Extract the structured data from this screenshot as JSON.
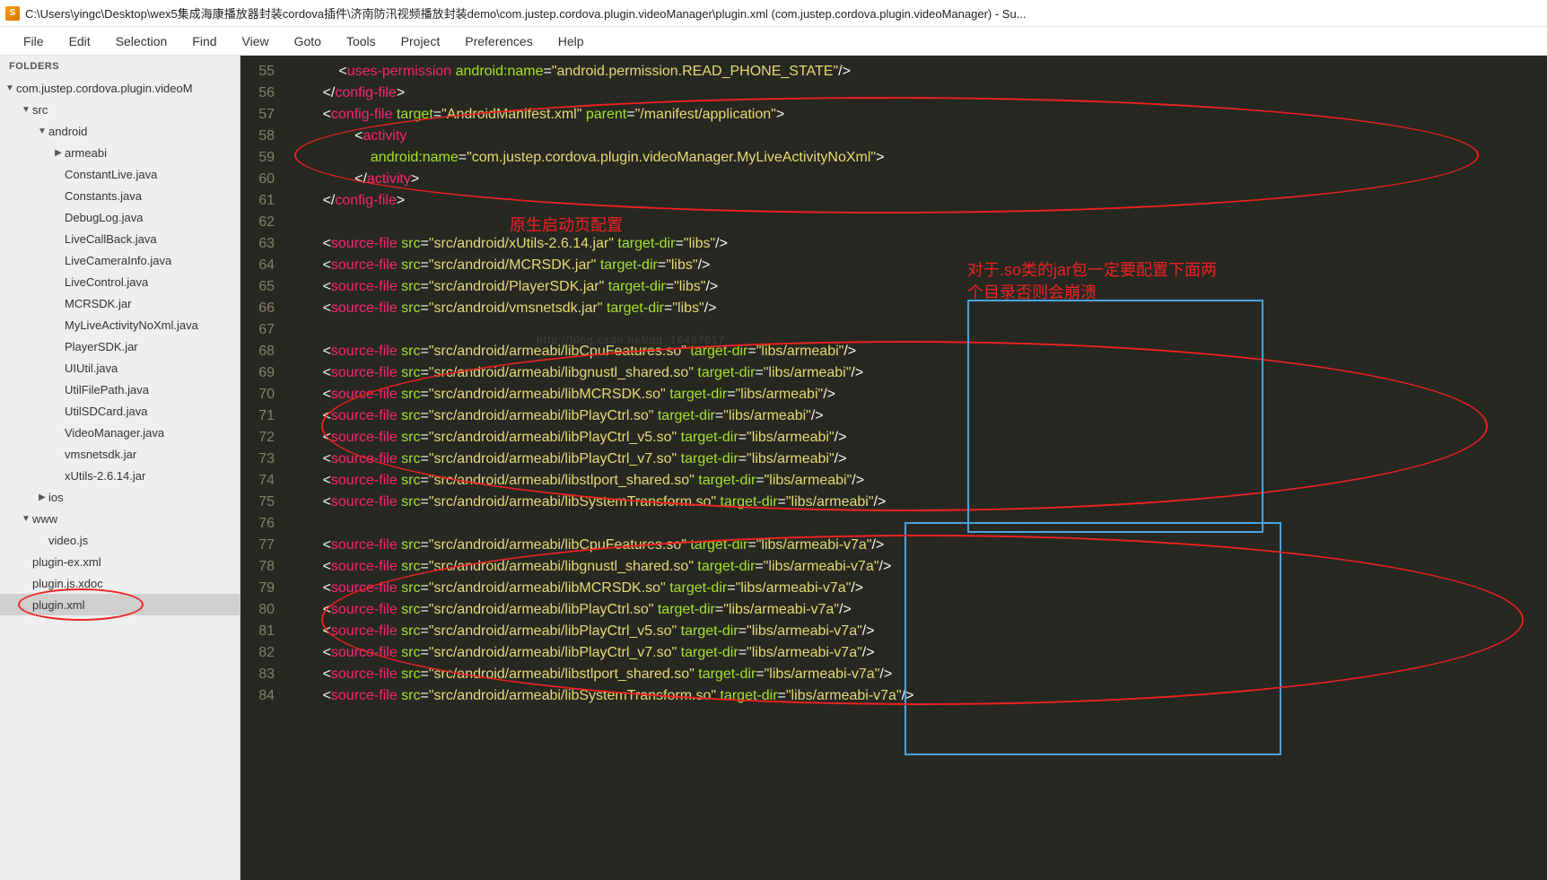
{
  "title": "C:\\Users\\yingc\\Desktop\\wex5集成海康播放器封装cordova插件\\济南防汛视频播放封装demo\\com.justep.cordova.plugin.videoManager\\plugin.xml (com.justep.cordova.plugin.videoManager) - Su...",
  "menu": [
    "File",
    "Edit",
    "Selection",
    "Find",
    "View",
    "Goto",
    "Tools",
    "Project",
    "Preferences",
    "Help"
  ],
  "sidebar": {
    "header": "FOLDERS",
    "tree": [
      {
        "label": "com.justep.cordova.plugin.videoM",
        "indent": 0,
        "arrow": "▼"
      },
      {
        "label": "src",
        "indent": 1,
        "arrow": "▼"
      },
      {
        "label": "android",
        "indent": 2,
        "arrow": "▼"
      },
      {
        "label": "armeabi",
        "indent": 3,
        "arrow": "▶"
      },
      {
        "label": "ConstantLive.java",
        "indent": 3,
        "arrow": ""
      },
      {
        "label": "Constants.java",
        "indent": 3,
        "arrow": ""
      },
      {
        "label": "DebugLog.java",
        "indent": 3,
        "arrow": ""
      },
      {
        "label": "LiveCallBack.java",
        "indent": 3,
        "arrow": ""
      },
      {
        "label": "LiveCameraInfo.java",
        "indent": 3,
        "arrow": ""
      },
      {
        "label": "LiveControl.java",
        "indent": 3,
        "arrow": ""
      },
      {
        "label": "MCRSDK.jar",
        "indent": 3,
        "arrow": ""
      },
      {
        "label": "MyLiveActivityNoXml.java",
        "indent": 3,
        "arrow": ""
      },
      {
        "label": "PlayerSDK.jar",
        "indent": 3,
        "arrow": ""
      },
      {
        "label": "UIUtil.java",
        "indent": 3,
        "arrow": ""
      },
      {
        "label": "UtilFilePath.java",
        "indent": 3,
        "arrow": ""
      },
      {
        "label": "UtilSDCard.java",
        "indent": 3,
        "arrow": ""
      },
      {
        "label": "VideoManager.java",
        "indent": 3,
        "arrow": ""
      },
      {
        "label": "vmsnetsdk.jar",
        "indent": 3,
        "arrow": ""
      },
      {
        "label": "xUtils-2.6.14.jar",
        "indent": 3,
        "arrow": ""
      },
      {
        "label": "ios",
        "indent": 2,
        "arrow": "▶"
      },
      {
        "label": "www",
        "indent": 1,
        "arrow": "▼"
      },
      {
        "label": "video.js",
        "indent": 2,
        "arrow": ""
      },
      {
        "label": "plugin-ex.xml",
        "indent": 1,
        "arrow": ""
      },
      {
        "label": "plugin.js.xdoc",
        "indent": 1,
        "arrow": ""
      },
      {
        "label": "plugin.xml",
        "indent": 1,
        "arrow": "",
        "selected": true
      }
    ]
  },
  "annotations": {
    "native_launch": "原生启动页配置",
    "so_note_l1": "对于.so类的jar包一定要配置下面两",
    "so_note_l2": "个目录否则会崩溃",
    "watermark": "http://blog.csdn.net/qq_16497617"
  },
  "code": [
    {
      "n": 55,
      "html": "    <span class='punct'>&lt;</span><span class='tag'>uses-permission</span> <span class='attr'>android:name</span><span class='punct'>=</span><span class='str'>\"android.permission.READ_PHONE_STATE\"</span><span class='punct'>/&gt;</span>"
    },
    {
      "n": 56,
      "html": "<span class='punct'>&lt;/</span><span class='tag'>config-file</span><span class='punct'>&gt;</span>"
    },
    {
      "n": 57,
      "html": "<span class='punct'>&lt;</span><span class='tag'>config-file</span> <span class='attr'>target</span><span class='punct'>=</span><span class='str'>\"AndroidManifest.xml\"</span> <span class='attr'>parent</span><span class='punct'>=</span><span class='str'>\"/manifest/application\"</span><span class='punct'>&gt;</span>"
    },
    {
      "n": 58,
      "html": "        <span class='punct'>&lt;</span><span class='tag'>activity</span>"
    },
    {
      "n": 59,
      "html": "            <span class='attr'>android:name</span><span class='punct'>=</span><span class='str'>\"com.justep.cordova.plugin.videoManager.MyLiveActivityNoXml\"</span><span class='punct'>&gt;</span>"
    },
    {
      "n": 60,
      "html": "        <span class='punct'>&lt;/</span><span class='tag'>activity</span><span class='punct'>&gt;</span>"
    },
    {
      "n": 61,
      "html": "<span class='punct'>&lt;/</span><span class='tag'>config-file</span><span class='punct'>&gt;</span>"
    },
    {
      "n": 62,
      "html": ""
    },
    {
      "n": 63,
      "html": "<span class='punct'>&lt;</span><span class='tag'>source-file</span> <span class='attr'>src</span><span class='punct'>=</span><span class='str'>\"src/android/xUtils-2.6.14.jar\"</span> <span class='attr'>target-dir</span><span class='punct'>=</span><span class='str'>\"libs\"</span><span class='punct'>/&gt;</span>"
    },
    {
      "n": 64,
      "html": "<span class='punct'>&lt;</span><span class='tag'>source-file</span> <span class='attr'>src</span><span class='punct'>=</span><span class='str'>\"src/android/MCRSDK.jar\"</span> <span class='attr'>target-dir</span><span class='punct'>=</span><span class='str'>\"libs\"</span><span class='punct'>/&gt;</span>"
    },
    {
      "n": 65,
      "html": "<span class='punct'>&lt;</span><span class='tag'>source-file</span> <span class='attr'>src</span><span class='punct'>=</span><span class='str'>\"src/android/PlayerSDK.jar\"</span> <span class='attr'>target-dir</span><span class='punct'>=</span><span class='str'>\"libs\"</span><span class='punct'>/&gt;</span>"
    },
    {
      "n": 66,
      "html": "<span class='punct'>&lt;</span><span class='tag'>source-file</span> <span class='attr'>src</span><span class='punct'>=</span><span class='str'>\"src/android/vmsnetsdk.jar\"</span> <span class='attr'>target-dir</span><span class='punct'>=</span><span class='str'>\"libs\"</span><span class='punct'>/&gt;</span>"
    },
    {
      "n": 67,
      "html": ""
    },
    {
      "n": 68,
      "html": "<span class='punct'>&lt;</span><span class='tag'>source-file</span> <span class='attr'>src</span><span class='punct'>=</span><span class='str'>\"src/android/armeabi/libCpuFeatures.so\"</span> <span class='attr'>target-dir</span><span class='punct'>=</span><span class='str'>\"libs/armeabi\"</span><span class='punct'>/&gt;</span>"
    },
    {
      "n": 69,
      "html": "<span class='punct'>&lt;</span><span class='tag'>source-file</span> <span class='attr'>src</span><span class='punct'>=</span><span class='str'>\"src/android/armeabi/libgnustl_shared.so\"</span> <span class='attr'>target-dir</span><span class='punct'>=</span><span class='str'>\"libs/armeabi\"</span><span class='punct'>/&gt;</span>"
    },
    {
      "n": 70,
      "html": "<span class='punct'>&lt;</span><span class='tag'>source-file</span> <span class='attr'>src</span><span class='punct'>=</span><span class='str'>\"src/android/armeabi/libMCRSDK.so\"</span> <span class='attr'>target-dir</span><span class='punct'>=</span><span class='str'>\"libs/armeabi\"</span><span class='punct'>/&gt;</span>"
    },
    {
      "n": 71,
      "html": "<span class='punct'>&lt;</span><span class='tag'>source-file</span> <span class='attr'>src</span><span class='punct'>=</span><span class='str'>\"src/android/armeabi/libPlayCtrl.so\"</span> <span class='attr'>target-dir</span><span class='punct'>=</span><span class='str'>\"libs/armeabi\"</span><span class='punct'>/&gt;</span>"
    },
    {
      "n": 72,
      "html": "<span class='punct'>&lt;</span><span class='tag'>source-file</span> <span class='attr'>src</span><span class='punct'>=</span><span class='str'>\"src/android/armeabi/libPlayCtrl_v5.so\"</span> <span class='attr'>target-dir</span><span class='punct'>=</span><span class='str'>\"libs/armeabi\"</span><span class='punct'>/&gt;</span>"
    },
    {
      "n": 73,
      "html": "<span class='punct'>&lt;</span><span class='tag'>source-file</span> <span class='attr'>src</span><span class='punct'>=</span><span class='str'>\"src/android/armeabi/libPlayCtrl_v7.so\"</span> <span class='attr'>target-dir</span><span class='punct'>=</span><span class='str'>\"libs/armeabi\"</span><span class='punct'>/&gt;</span>"
    },
    {
      "n": 74,
      "html": "<span class='punct'>&lt;</span><span class='tag'>source-file</span> <span class='attr'>src</span><span class='punct'>=</span><span class='str'>\"src/android/armeabi/libstlport_shared.so\"</span> <span class='attr'>target-dir</span><span class='punct'>=</span><span class='str'>\"libs/armeabi\"</span><span class='punct'>/&gt;</span>"
    },
    {
      "n": 75,
      "html": "<span class='punct'>&lt;</span><span class='tag'>source-file</span> <span class='attr'>src</span><span class='punct'>=</span><span class='str'>\"src/android/armeabi/libSystemTransform.so\"</span> <span class='attr'>target-dir</span><span class='punct'>=</span><span class='str'>\"libs/armeabi\"</span><span class='punct'>/&gt;</span>"
    },
    {
      "n": 76,
      "html": ""
    },
    {
      "n": 77,
      "html": "<span class='punct'>&lt;</span><span class='tag'>source-file</span> <span class='attr'>src</span><span class='punct'>=</span><span class='str'>\"src/android/armeabi/libCpuFeatures.so\"</span> <span class='attr'>target-dir</span><span class='punct'>=</span><span class='str'>\"libs/armeabi-v7a\"</span><span class='punct'>/&gt;</span>"
    },
    {
      "n": 78,
      "html": "<span class='punct'>&lt;</span><span class='tag'>source-file</span> <span class='attr'>src</span><span class='punct'>=</span><span class='str'>\"src/android/armeabi/libgnustl_shared.so\"</span> <span class='attr'>target-dir</span><span class='punct'>=</span><span class='str'>\"libs/armeabi-v7a\"</span><span class='punct'>/&gt;</span>"
    },
    {
      "n": 79,
      "html": "<span class='punct'>&lt;</span><span class='tag'>source-file</span> <span class='attr'>src</span><span class='punct'>=</span><span class='str'>\"src/android/armeabi/libMCRSDK.so\"</span> <span class='attr'>target-dir</span><span class='punct'>=</span><span class='str'>\"libs/armeabi-v7a\"</span><span class='punct'>/&gt;</span>"
    },
    {
      "n": 80,
      "html": "<span class='punct'>&lt;</span><span class='tag'>source-file</span> <span class='attr'>src</span><span class='punct'>=</span><span class='str'>\"src/android/armeabi/libPlayCtrl.so\"</span> <span class='attr'>target-dir</span><span class='punct'>=</span><span class='str'>\"libs/armeabi-v7a\"</span><span class='punct'>/&gt;</span>"
    },
    {
      "n": 81,
      "html": "<span class='punct'>&lt;</span><span class='tag'>source-file</span> <span class='attr'>src</span><span class='punct'>=</span><span class='str'>\"src/android/armeabi/libPlayCtrl_v5.so\"</span> <span class='attr'>target-dir</span><span class='punct'>=</span><span class='str'>\"libs/armeabi-v7a\"</span><span class='punct'>/&gt;</span>"
    },
    {
      "n": 82,
      "html": "<span class='punct'>&lt;</span><span class='tag'>source-file</span> <span class='attr'>src</span><span class='punct'>=</span><span class='str'>\"src/android/armeabi/libPlayCtrl_v7.so\"</span> <span class='attr'>target-dir</span><span class='punct'>=</span><span class='str'>\"libs/armeabi-v7a\"</span><span class='punct'>/&gt;</span>"
    },
    {
      "n": 83,
      "html": "<span class='punct'>&lt;</span><span class='tag'>source-file</span> <span class='attr'>src</span><span class='punct'>=</span><span class='str'>\"src/android/armeabi/libstlport_shared.so\"</span> <span class='attr'>target-dir</span><span class='punct'>=</span><span class='str'>\"libs/armeabi-v7a\"</span><span class='punct'>/&gt;</span>"
    },
    {
      "n": 84,
      "html": "<span class='punct'>&lt;</span><span class='tag'>source-file</span> <span class='attr'>src</span><span class='punct'>=</span><span class='str'>\"src/android/armeabi/libSystemTransform.so\"</span> <span class='attr'>target-dir</span><span class='punct'>=</span><span class='str'>\"libs/armeabi-v7a\"</span><span class='punct'>/&gt;</span>"
    }
  ]
}
